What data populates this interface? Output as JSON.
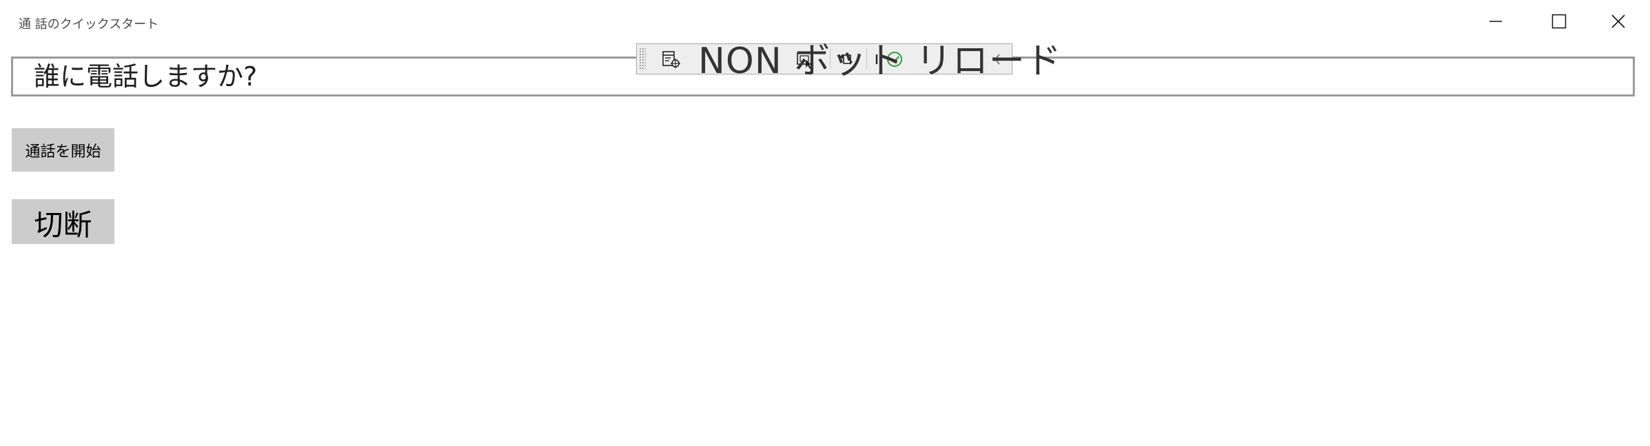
{
  "window": {
    "title": "通 話のクイックスタート",
    "minimize_icon": "minimize-icon",
    "maximize_icon": "maximize-icon",
    "close_icon": "close-icon"
  },
  "search": {
    "placeholder": "誰に電話しますか?",
    "value": ""
  },
  "buttons": {
    "start_call": "通話を開始",
    "hang_up": "切断"
  },
  "overlay_toolbar": {
    "label": "NON ボット リロード",
    "icons": [
      "live-visual-tree-icon",
      "select-element-icon",
      "display-layout-adorners-icon",
      "track-focus-icon",
      "binding-failures-icon",
      "collapse-chevron-icon"
    ],
    "accent_color": "#2e9e3f"
  }
}
